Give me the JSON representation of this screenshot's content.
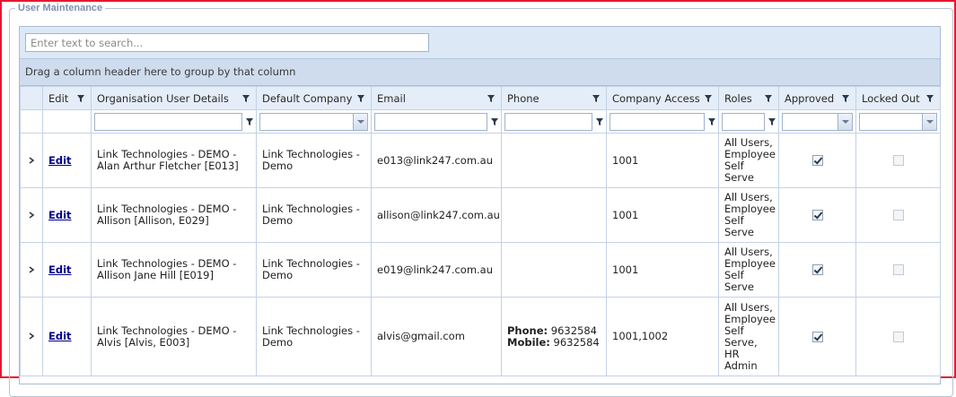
{
  "panel": {
    "title": "User Maintenance"
  },
  "search": {
    "placeholder": "Enter text to search..."
  },
  "group_panel": {
    "text": "Drag a column header here to group by that column"
  },
  "columns": [
    {
      "label": "Edit"
    },
    {
      "label": "Organisation User Details"
    },
    {
      "label": "Default Company"
    },
    {
      "label": "Email"
    },
    {
      "label": "Phone"
    },
    {
      "label": "Company Access"
    },
    {
      "label": "Roles"
    },
    {
      "label": "Approved"
    },
    {
      "label": "Locked Out"
    }
  ],
  "rows": [
    {
      "edit": "Edit",
      "details": "Link Technologies - DEMO - Alan Arthur Fletcher [E013]",
      "company": "Link Technologies - Demo",
      "email": "e013@link247.com.au",
      "phone_label": "",
      "phone": "",
      "mobile_label": "",
      "mobile": "",
      "access": "1001",
      "roles": "All Users, Employee Self Serve",
      "approved": true,
      "locked": false
    },
    {
      "edit": "Edit",
      "details": "Link Technologies - DEMO - Allison [Allison, E029]",
      "company": "Link Technologies - Demo",
      "email": "allison@link247.com.au",
      "phone_label": "",
      "phone": "",
      "mobile_label": "",
      "mobile": "",
      "access": "1001",
      "roles": "All Users, Employee Self Serve",
      "approved": true,
      "locked": false
    },
    {
      "edit": "Edit",
      "details": "Link Technologies - DEMO - Allison Jane Hill [E019]",
      "company": "Link Technologies - Demo",
      "email": "e019@link247.com.au",
      "phone_label": "",
      "phone": "",
      "mobile_label": "",
      "mobile": "",
      "access": "1001",
      "roles": "All Users, Employee Self Serve",
      "approved": true,
      "locked": false
    },
    {
      "edit": "Edit",
      "details": "Link Technologies - DEMO - Alvis [Alvis, E003]",
      "company": "Link Technologies - Demo",
      "email": "alvis@gmail.com",
      "phone_label": "Phone:",
      "phone": "9632584",
      "mobile_label": "Mobile:",
      "mobile": "9632584",
      "access": "1001,1002",
      "roles": "All Users, Employee Self Serve, HR Admin",
      "approved": true,
      "locked": false
    }
  ],
  "colors": {
    "frame": "#e8172f",
    "header_bg": "#e4edf8",
    "search_bg": "#dde8f6",
    "group_panel_bg": "#cfdcee",
    "link": "#00008b"
  },
  "icons": {
    "filter": "filter-icon",
    "expand": "chevron-right-icon",
    "dropdown": "chevron-down-icon"
  }
}
